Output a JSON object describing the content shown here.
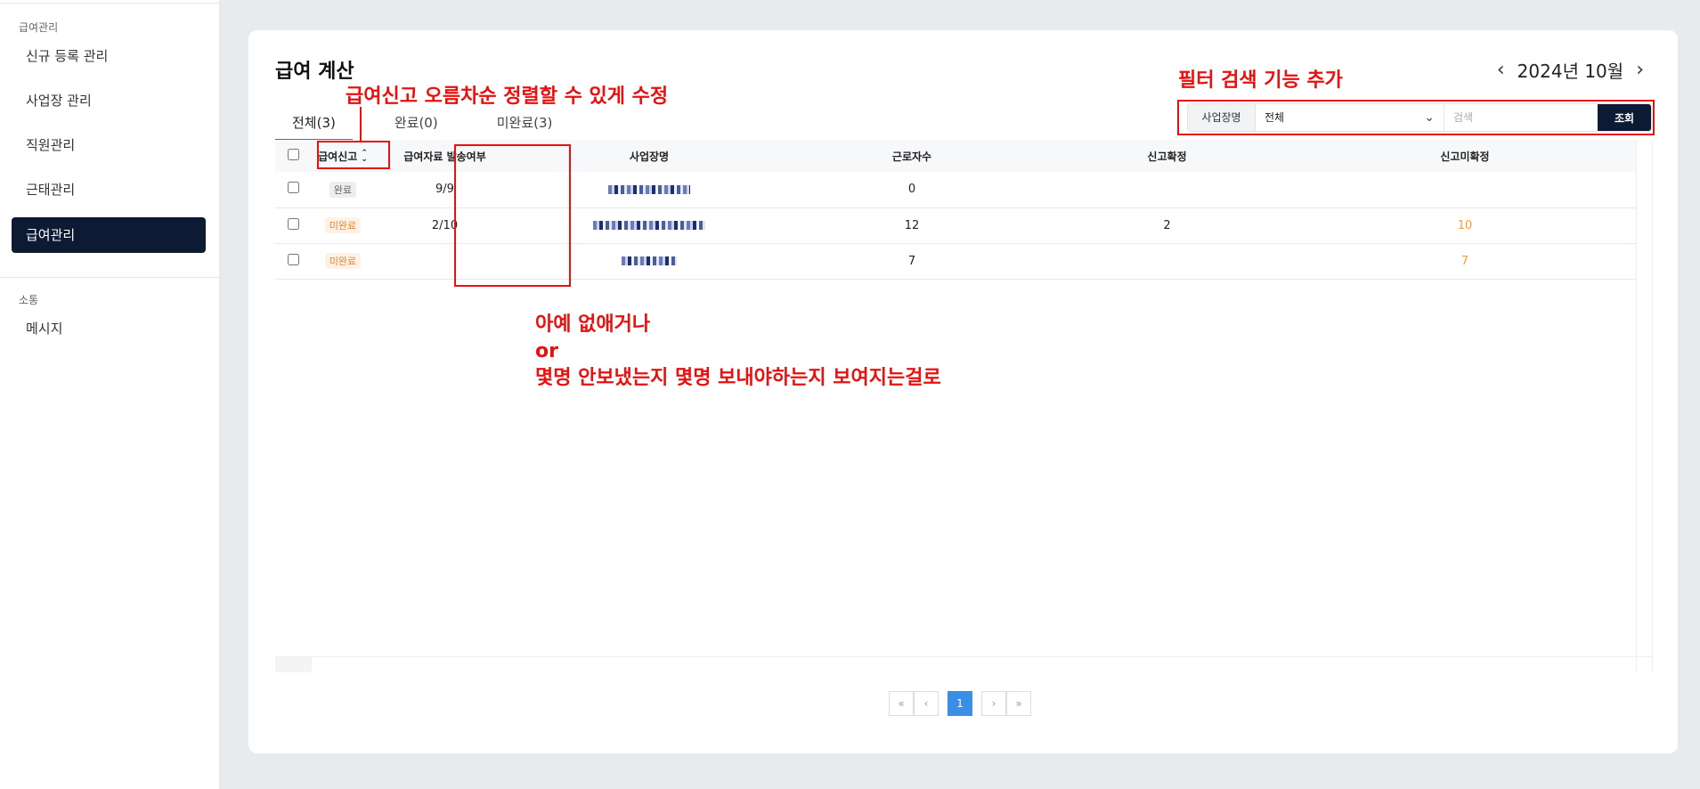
{
  "sidebar": {
    "section1_title": "급여관리",
    "items": [
      {
        "label": "신규 등록 관리"
      },
      {
        "label": "사업장 관리"
      },
      {
        "label": "직원관리"
      },
      {
        "label": "근태관리"
      },
      {
        "label": "급여관리",
        "active": true
      }
    ],
    "section2_title": "소통",
    "items2": [
      {
        "label": "메시지"
      }
    ]
  },
  "page": {
    "title": "급여 계산",
    "month_label": "2024년 10월",
    "tabs": [
      {
        "label": "전체(3)",
        "active": true
      },
      {
        "label": "완료(0)"
      },
      {
        "label": "미완료(3)"
      }
    ]
  },
  "filter": {
    "label": "사업장명",
    "select_value": "전체",
    "search_placeholder": "검색",
    "button": "조회"
  },
  "table": {
    "headers": [
      "급여신고",
      "급여자료 발송여부",
      "사업장명",
      "근로자수",
      "신고확정",
      "신고미확정"
    ],
    "rows": [
      {
        "status": "완료",
        "sent": "9/9",
        "workers": "0",
        "confirmed": "",
        "unconfirmed": ""
      },
      {
        "status": "미완료",
        "sent": "2/10",
        "workers": "12",
        "confirmed": "2",
        "unconfirmed": "10"
      },
      {
        "status": "미완료",
        "sent": "",
        "workers": "7",
        "confirmed": "",
        "unconfirmed": "7"
      }
    ]
  },
  "pagination": {
    "first": "«",
    "prev": "‹",
    "current": "1",
    "next": "›",
    "last": "»"
  },
  "annotations": {
    "sort_note": "급여신고 오름차순 정렬할 수 있게 수정",
    "filter_note": "필터 검색 기능 추가",
    "column_note_line1": "아예 없애거나",
    "column_note_line2": "or",
    "column_note_line3": "몇명 안보냈는지 몇명 보내야하는지 보여지는걸로",
    "color": "#e8110f"
  }
}
